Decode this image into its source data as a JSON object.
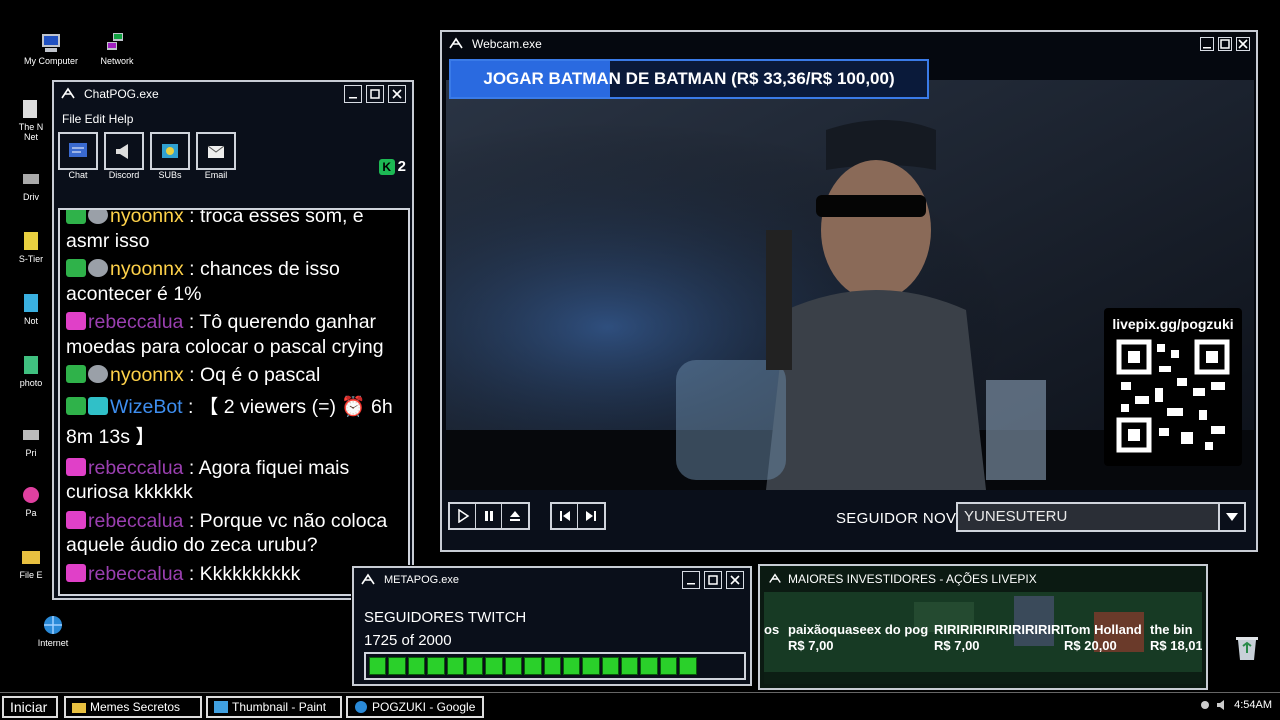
{
  "desktop": {
    "icons": [
      {
        "label": "My Computer"
      },
      {
        "label": "Network"
      },
      {
        "label": "The N Net"
      },
      {
        "label": "Driv"
      },
      {
        "label": "S-Tier"
      },
      {
        "label": "Not"
      },
      {
        "label": "photo"
      },
      {
        "label": "Pri"
      },
      {
        "label": "Pa"
      },
      {
        "label": "File E"
      },
      {
        "label": "Internet"
      }
    ]
  },
  "chat_window": {
    "title": "ChatPOG.exe",
    "menu": "File Edit Help",
    "tools": [
      {
        "label": "Chat",
        "icon": "chat-icon"
      },
      {
        "label": "Discord",
        "icon": "megaphone-icon"
      },
      {
        "label": "SUBs",
        "icon": "subs-icon"
      },
      {
        "label": "Email",
        "icon": "email-icon"
      }
    ],
    "badge_count": "2",
    "messages": [
      {
        "user": "nyoonnx",
        "text": "troca esses som, e asmr isso",
        "badge": "mod"
      },
      {
        "user": "nyoonnx",
        "text": "chances de isso acontecer é 1%",
        "badge": "mod"
      },
      {
        "user": "rebeccalua",
        "text": "Tô querendo ganhar moedas para colocar o pascal crying",
        "badge": "pink"
      },
      {
        "user": "nyoonnx",
        "text": "Oq é o pascal",
        "badge": "mod"
      },
      {
        "user": "WizeBot",
        "text": "【 2 viewers (=) ⏰ 6h 8m 13s 】",
        "badge": "bot"
      },
      {
        "user": "rebeccalua",
        "text": "Agora fiquei mais curiosa kkkkkk",
        "badge": "pink"
      },
      {
        "user": "rebeccalua",
        "text": "Porque vc não coloca aquele áudio do zeca urubu?",
        "badge": "pink"
      },
      {
        "user": "rebeccalua",
        "text": "Kkkkkkkkkk",
        "badge": "pink"
      }
    ]
  },
  "webcam_window": {
    "title": "Webcam.exe",
    "goal_text": "JOGAR BATMAN DE BATMAN (R$ 33,36/R$ 100,00)",
    "goal_progress": 0.3336,
    "qr_label": "livepix.gg/pogzuki",
    "follower_label": "SEGUIDOR NOVO",
    "follower_name": "YUNESUTERU"
  },
  "meta_window": {
    "title": "METAPOG.exe",
    "goal_title": "SEGUIDORES TWITCH",
    "goal_count": "1725 of 2000",
    "progress": 0.8625
  },
  "investors_window": {
    "title": "MAIORES INVESTIDORES - AÇÕES LIVEPIX",
    "entries": [
      {
        "name": "os",
        "amount": ""
      },
      {
        "name": "paixãoquaseex do pog",
        "amount": "R$ 7,00"
      },
      {
        "name": "RIRIRIRIRIRIRIRIRIRI",
        "amount": "R$ 7,00"
      },
      {
        "name": "Tom Holland",
        "amount": "R$ 20,00"
      },
      {
        "name": "the bin",
        "amount": "R$ 18,01"
      }
    ]
  },
  "taskbar": {
    "start": "Iniciar",
    "items": [
      {
        "label": "Memes Secretos"
      },
      {
        "label": "Thumbnail - Paint"
      },
      {
        "label": "POGZUKI - Google"
      }
    ],
    "clock": "4:54AM"
  },
  "colors": {
    "accent": "#2a6ae0",
    "mod_badge": "#2fb24a",
    "progress_green": "#2ad02a"
  }
}
